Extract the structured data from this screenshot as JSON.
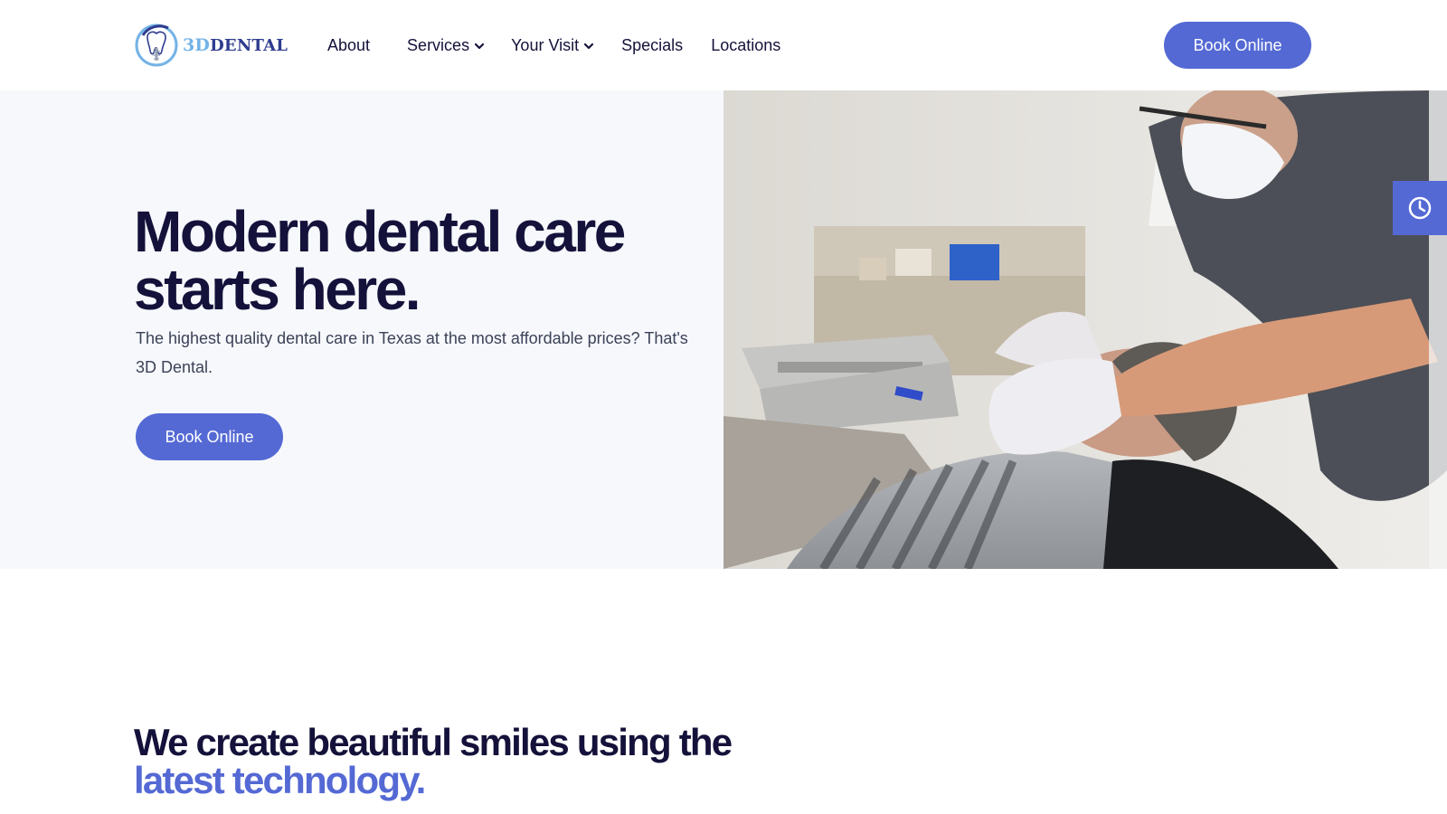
{
  "brand": {
    "name_3d": "3D",
    "name_dental": "DENTAL"
  },
  "nav": {
    "items": [
      {
        "label": "About",
        "has_dropdown": false
      },
      {
        "label": "Services",
        "has_dropdown": true
      },
      {
        "label": "Your Visit",
        "has_dropdown": true
      },
      {
        "label": "Specials",
        "has_dropdown": false
      },
      {
        "label": "Locations",
        "has_dropdown": false
      }
    ],
    "cta_label": "Book Online"
  },
  "hero": {
    "title_line1": "Modern dental care",
    "title_line2": "starts here.",
    "subtitle": "The highest quality dental care in Texas at the most affordable prices? That's 3D Dental.",
    "cta_label": "Book Online"
  },
  "section2": {
    "title_line1": "We create beautiful smiles using the",
    "title_line2": "latest technology."
  },
  "side_widget": {
    "icon": "clock-icon"
  },
  "colors": {
    "accent": "#5469d4",
    "heading": "#14123a",
    "body_text": "#3c4257",
    "hero_bg": "#f6f8fc",
    "logo_light_blue": "#74b3e6",
    "logo_dark_blue": "#2f3d8f"
  }
}
